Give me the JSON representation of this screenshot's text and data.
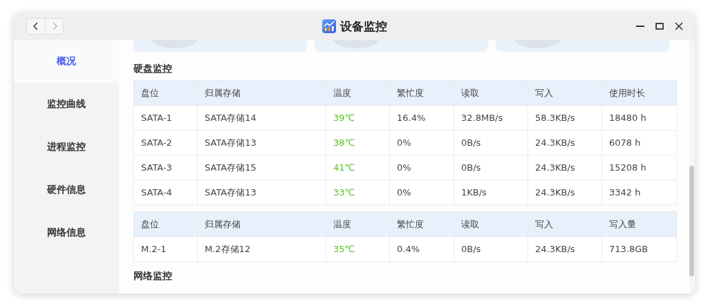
{
  "window": {
    "title": "设备监控"
  },
  "sidebar": {
    "items": [
      {
        "label": "概况",
        "selected": true
      },
      {
        "label": "监控曲线",
        "selected": false
      },
      {
        "label": "进程监控",
        "selected": false
      },
      {
        "label": "硬件信息",
        "selected": false
      },
      {
        "label": "网络信息",
        "selected": false
      }
    ]
  },
  "disk_monitor": {
    "title": "硬盘监控",
    "tables": [
      {
        "columns": [
          "盘位",
          "归属存储",
          "温度",
          "繁忙度",
          "读取",
          "写入",
          "使用时长"
        ],
        "rows": [
          [
            "SATA-1",
            "SATA存储14",
            "39℃",
            "16.4%",
            "32.8MB/s",
            "58.3KB/s",
            "18480 h"
          ],
          [
            "SATA-2",
            "SATA存储13",
            "38℃",
            "0%",
            "0B/s",
            "24.3KB/s",
            "6078 h"
          ],
          [
            "SATA-3",
            "SATA存储15",
            "41℃",
            "0%",
            "0B/s",
            "24.3KB/s",
            "15208 h"
          ],
          [
            "SATA-4",
            "SATA存储13",
            "33℃",
            "0%",
            "1KB/s",
            "24.3KB/s",
            "3342 h"
          ]
        ]
      },
      {
        "columns": [
          "盘位",
          "归属存储",
          "温度",
          "繁忙度",
          "读取",
          "写入",
          "写入量"
        ],
        "rows": [
          [
            "M.2-1",
            "M.2存储12",
            "35℃",
            "0.4%",
            "0B/s",
            "24.3KB/s",
            "713.8GB"
          ]
        ]
      }
    ]
  },
  "network_monitor": {
    "title": "网络监控"
  }
}
